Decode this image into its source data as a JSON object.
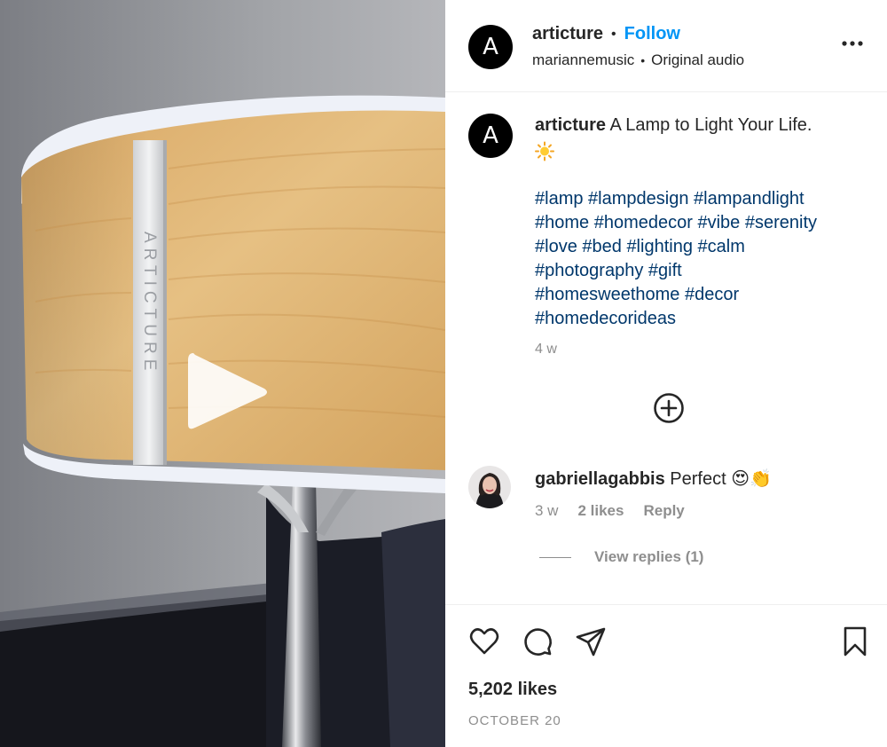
{
  "post": {
    "media_brand_text": "ARTICTURE",
    "author": {
      "avatar_letter": "A",
      "username": "articture",
      "follow_label": "Follow",
      "audio_artist": "mariannemusic",
      "audio_label": "Original audio"
    },
    "caption": {
      "username": "articture",
      "text": "A Lamp to Light Your Life.",
      "emoji": "sun",
      "hashtag_lines": [
        [
          "#lamp",
          "#lampdesign",
          "#lampandlight"
        ],
        [
          "#home",
          "#homedecor",
          "#vibe",
          "#serenity"
        ],
        [
          "#love",
          "#bed",
          "#lighting",
          "#calm"
        ],
        [
          "#photography",
          "#gift"
        ],
        [
          "#homesweethome",
          "#decor"
        ],
        [
          "#homedecorideas"
        ]
      ],
      "time": "4 w"
    },
    "comment": {
      "username": "gabriellagabbis",
      "text": "Perfect",
      "emojis": "😍👏",
      "time": "3 w",
      "likes": "2 likes",
      "reply_label": "Reply",
      "view_replies_label": "View replies (1)"
    },
    "likes_count": "5,202 likes",
    "date": "OCTOBER 20"
  },
  "colors": {
    "follow": "#0095f6",
    "hashtag": "#00376b",
    "muted": "#8e8e8e",
    "text": "#262626",
    "wood": "#e2b877"
  },
  "icons": [
    "play-icon",
    "more-options-icon",
    "add-comment-icon",
    "heart-icon",
    "comment-icon",
    "share-icon",
    "bookmark-icon",
    "sun-icon"
  ]
}
